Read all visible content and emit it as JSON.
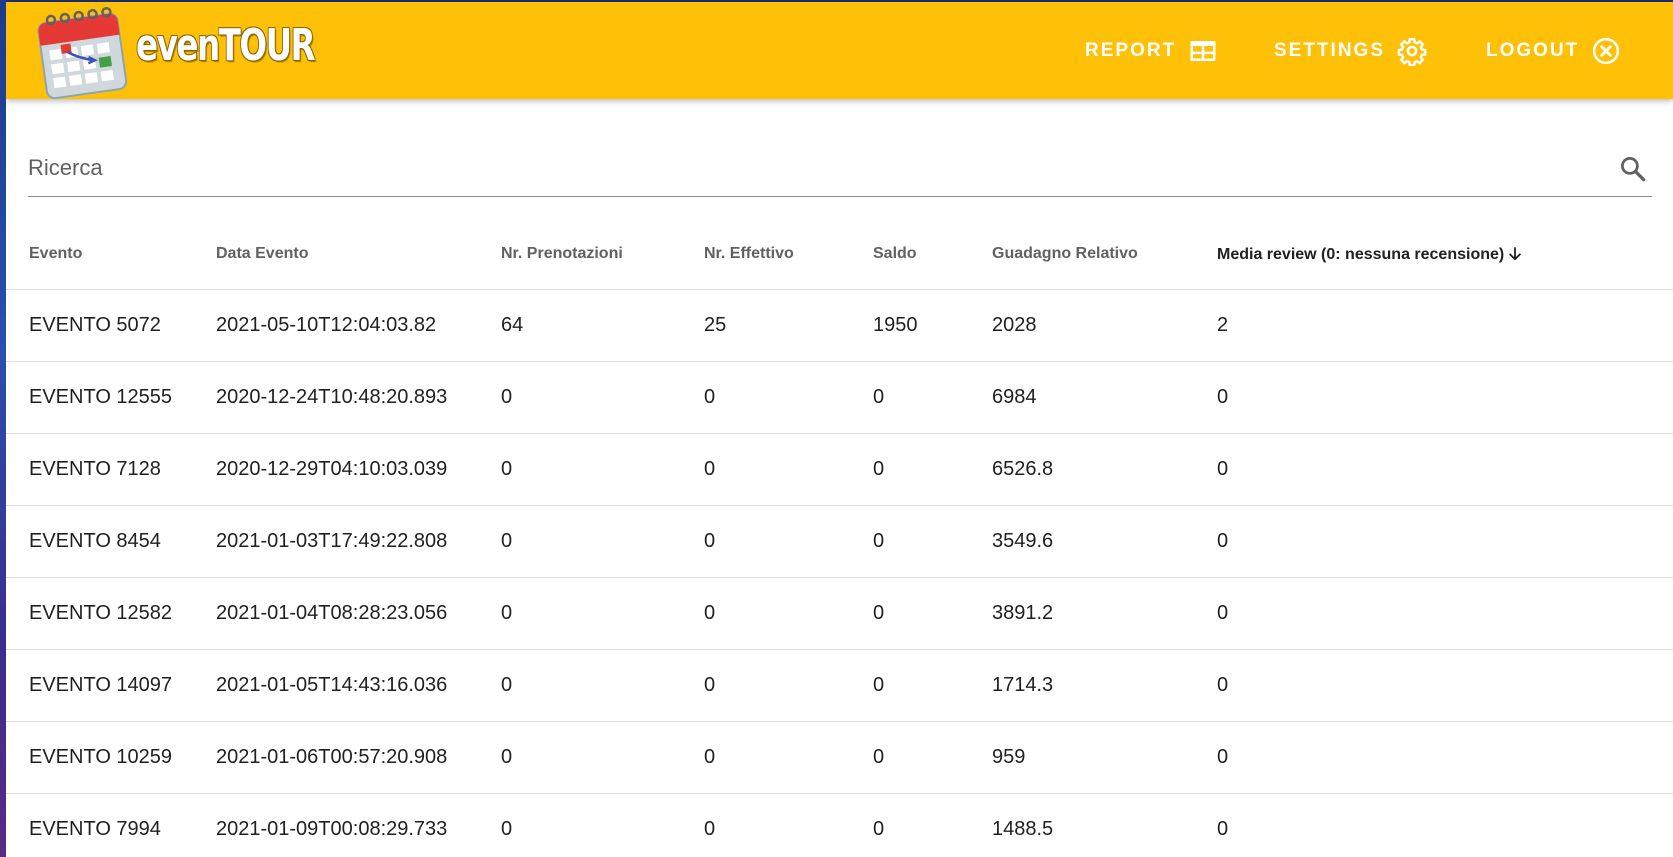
{
  "app": {
    "brand": "evenTOUR",
    "colors": {
      "header": "#ffc107",
      "header_text": "#ffffff"
    }
  },
  "nav": {
    "report": {
      "label": "REPORT",
      "icon": "table-grid-icon"
    },
    "settings": {
      "label": "SETTINGS",
      "icon": "gear-icon"
    },
    "logout": {
      "label": "LOGOUT",
      "icon": "close-circle-icon"
    }
  },
  "search": {
    "placeholder": "Ricerca",
    "value": "",
    "icon": "search-icon"
  },
  "table": {
    "columns": [
      "Evento",
      "Data Evento",
      "Nr. Prenotazioni",
      "Nr. Effettivo",
      "Saldo",
      "Guadagno Relativo",
      "Media review (0: nessuna recensione)"
    ],
    "sorted_column": 6,
    "sort_direction": "descending",
    "rows": [
      [
        "EVENTO 5072",
        "2021-05-10T12:04:03.82",
        "64",
        "25",
        "1950",
        "2028",
        "2"
      ],
      [
        "EVENTO 12555",
        "2020-12-24T10:48:20.893",
        "0",
        "0",
        "0",
        "6984",
        "0"
      ],
      [
        "EVENTO 7128",
        "2020-12-29T04:10:03.039",
        "0",
        "0",
        "0",
        "6526.8",
        "0"
      ],
      [
        "EVENTO 8454",
        "2021-01-03T17:49:22.808",
        "0",
        "0",
        "0",
        "3549.6",
        "0"
      ],
      [
        "EVENTO 12582",
        "2021-01-04T08:28:23.056",
        "0",
        "0",
        "0",
        "3891.2",
        "0"
      ],
      [
        "EVENTO 14097",
        "2021-01-05T14:43:16.036",
        "0",
        "0",
        "0",
        "1714.3",
        "0"
      ],
      [
        "EVENTO 10259",
        "2021-01-06T00:57:20.908",
        "0",
        "0",
        "0",
        "959",
        "0"
      ],
      [
        "EVENTO 7994",
        "2021-01-09T00:08:29.733",
        "0",
        "0",
        "0",
        "1488.5",
        "0"
      ]
    ]
  }
}
